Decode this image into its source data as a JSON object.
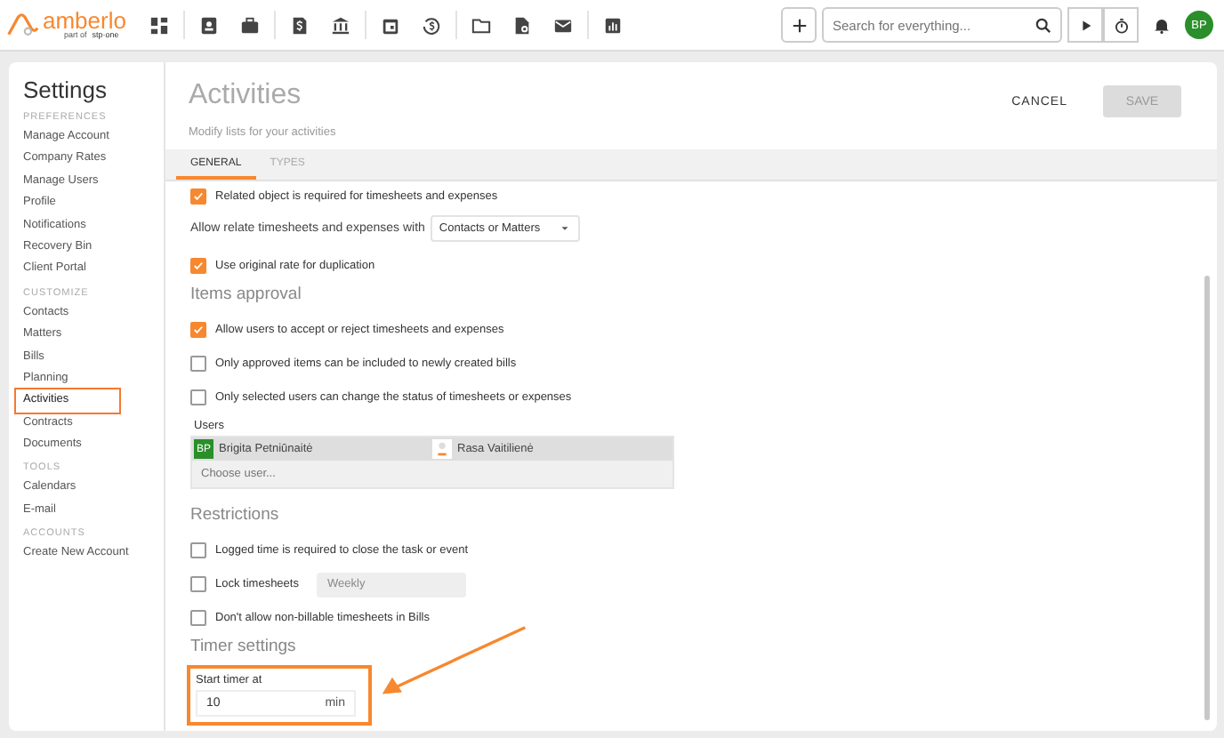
{
  "topbar": {
    "logo": "amberlo",
    "tagline": "part of",
    "tagline_brand": "stp·one",
    "search": {
      "placeholder": "Search for everything..."
    },
    "avatar": "BP"
  },
  "sidebar": {
    "title": "Settings",
    "sections": [
      {
        "heading": "PREFERENCES",
        "items": [
          {
            "label": "Manage Account",
            "selected": false
          },
          {
            "label": "Company Rates",
            "selected": false
          },
          {
            "label": "Manage Users",
            "selected": false
          },
          {
            "label": "Profile",
            "selected": false
          },
          {
            "label": "Notifications",
            "selected": false
          },
          {
            "label": "Recovery Bin",
            "selected": false
          },
          {
            "label": "Client Portal",
            "selected": false
          }
        ]
      },
      {
        "heading": "CUSTOMIZE",
        "items": [
          {
            "label": "Contacts",
            "selected": false
          },
          {
            "label": "Matters",
            "selected": false
          },
          {
            "label": "Bills",
            "selected": false
          },
          {
            "label": "Planning",
            "selected": false
          },
          {
            "label": "Activities",
            "selected": true
          },
          {
            "label": "Contracts",
            "selected": false
          },
          {
            "label": "Documents",
            "selected": false
          }
        ]
      },
      {
        "heading": "TOOLS",
        "items": [
          {
            "label": "Calendars",
            "selected": false
          },
          {
            "label": "E-mail",
            "selected": false
          }
        ]
      },
      {
        "heading": "ACCOUNTS",
        "items": [
          {
            "label": "Create New Account",
            "selected": false
          }
        ]
      }
    ]
  },
  "main": {
    "title": "Activities",
    "subtitle": "Modify lists for your activities",
    "cancel": "CANCEL",
    "save": {
      "label": "SAVE",
      "disabled": true
    },
    "tabs": [
      {
        "label": "GENERAL",
        "selected": true
      },
      {
        "label": "TYPES",
        "selected": false
      }
    ],
    "top_options": [
      {
        "label": "Related object is required for timesheets and expenses",
        "checked": true
      }
    ],
    "relate": {
      "label": "Allow relate timesheets and expenses with",
      "value": "Contacts or Matters"
    },
    "duplication": {
      "label": "Use original rate for duplication",
      "checked": true
    },
    "approval": {
      "heading": "Items approval",
      "options": [
        {
          "label": "Allow users to accept or reject timesheets and expenses",
          "checked": true
        },
        {
          "label": "Only approved items can be included to newly created bills",
          "checked": false
        },
        {
          "label": "Only selected users can change the status of timesheets or expenses",
          "checked": false
        }
      ],
      "users_label": "Users",
      "users": [
        {
          "name": "Brigita Petniūnaitė",
          "initials": "BP"
        },
        {
          "name": "Rasa Vaitilienė"
        }
      ],
      "choose_placeholder": "Choose user..."
    },
    "restrictions": {
      "heading": "Restrictions",
      "logged": {
        "label": "Logged time is required to close the task or event",
        "checked": false
      },
      "lock": {
        "label": "Lock timesheets",
        "checked": false,
        "period": "Weekly"
      },
      "nonbillable": {
        "label": "Don't allow non-billable timesheets in Bills",
        "checked": false
      }
    },
    "timer": {
      "heading": "Timer settings",
      "label": "Start timer at",
      "value": "10",
      "unit": "min"
    }
  }
}
